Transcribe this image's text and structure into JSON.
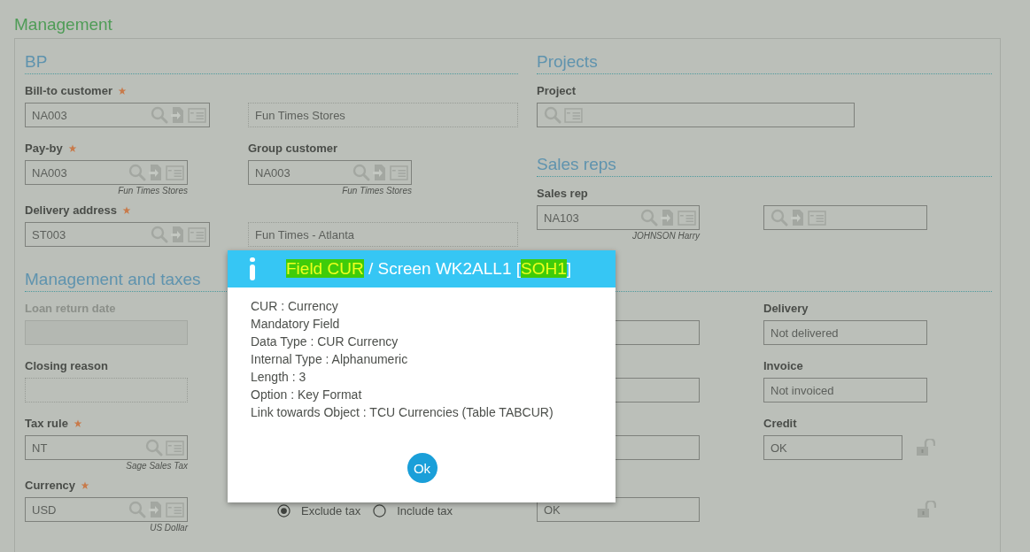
{
  "page_title": "Management",
  "sections": [
    {
      "kind": "bp",
      "title": "BP",
      "fields": [
        {
          "kind": "lookup",
          "label": "Bill-to customer",
          "required": true,
          "value": "NA003"
        },
        {
          "kind": "display",
          "value": "Fun Times Stores"
        },
        {
          "kind": "lookup",
          "label": "Pay-by",
          "required": true,
          "value": "NA003",
          "note": "Fun Times Stores"
        },
        {
          "kind": "lookup",
          "label": "Group customer",
          "required": false,
          "value": "NA003",
          "note": "Fun Times Stores"
        },
        {
          "kind": "lookup",
          "label": "Delivery address",
          "required": true,
          "value": "ST003"
        },
        {
          "kind": "display",
          "value": "Fun Times - Atlanta"
        }
      ]
    },
    {
      "kind": "projects",
      "title": "Projects",
      "fields": [
        {
          "kind": "reference",
          "label": "Project",
          "required": false
        }
      ]
    },
    {
      "kind": "sales",
      "title": "Sales reps",
      "fields": [
        {
          "kind": "lookup",
          "label": "Sales rep",
          "required": false,
          "value": "NA103",
          "note": "JOHNSON Harry"
        },
        {
          "kind": "lookup"
        }
      ]
    },
    {
      "kind": "taxes",
      "title": "Management and taxes",
      "fields": [
        {
          "kind": "disabled",
          "label": "Loan return date",
          "required": false
        },
        {
          "kind": "text"
        },
        {
          "kind": "text",
          "label": "Delivery",
          "required": false,
          "value": "Not delivered"
        },
        {
          "kind": "display",
          "label": "Closing reason",
          "required": false
        },
        {
          "kind": "text"
        },
        {
          "kind": "text",
          "label": "Invoice",
          "required": false,
          "value": "Not invoiced"
        },
        {
          "kind": "reference",
          "label": "Tax rule",
          "required": true,
          "value": "NT",
          "note": "Sage Sales Tax"
        },
        {
          "kind": "text"
        },
        {
          "kind": "text",
          "label": "Credit",
          "required": false,
          "value": "OK",
          "lock": true
        },
        {
          "kind": "lookup",
          "label": "Currency",
          "required": true,
          "value": "USD",
          "note": "US Dollar"
        },
        {
          "kind": "radio",
          "options": [
            {
              "label": "Exclude tax",
              "selected": true
            },
            {
              "label": "Include tax",
              "selected": false
            }
          ]
        },
        {
          "kind": "text",
          "value": "OK"
        },
        {
          "kind": "lock"
        }
      ]
    }
  ],
  "dialog": {
    "title_parts": [
      {
        "text": "Field CUR",
        "highlight": true
      },
      {
        "text": " / Screen WK2ALL1 [",
        "highlight": false
      },
      {
        "text": "SOH1",
        "highlight": true
      },
      {
        "text": "]",
        "highlight": false
      }
    ],
    "lines": [
      "CUR : Currency",
      "Mandatory Field",
      "Data Type : CUR Currency",
      "Internal Type : Alphanumeric",
      "Length : 3",
      "Option : Key Format",
      "Link towards Object : TCU Currencies (Table TABCUR)"
    ],
    "button": "Ok"
  }
}
